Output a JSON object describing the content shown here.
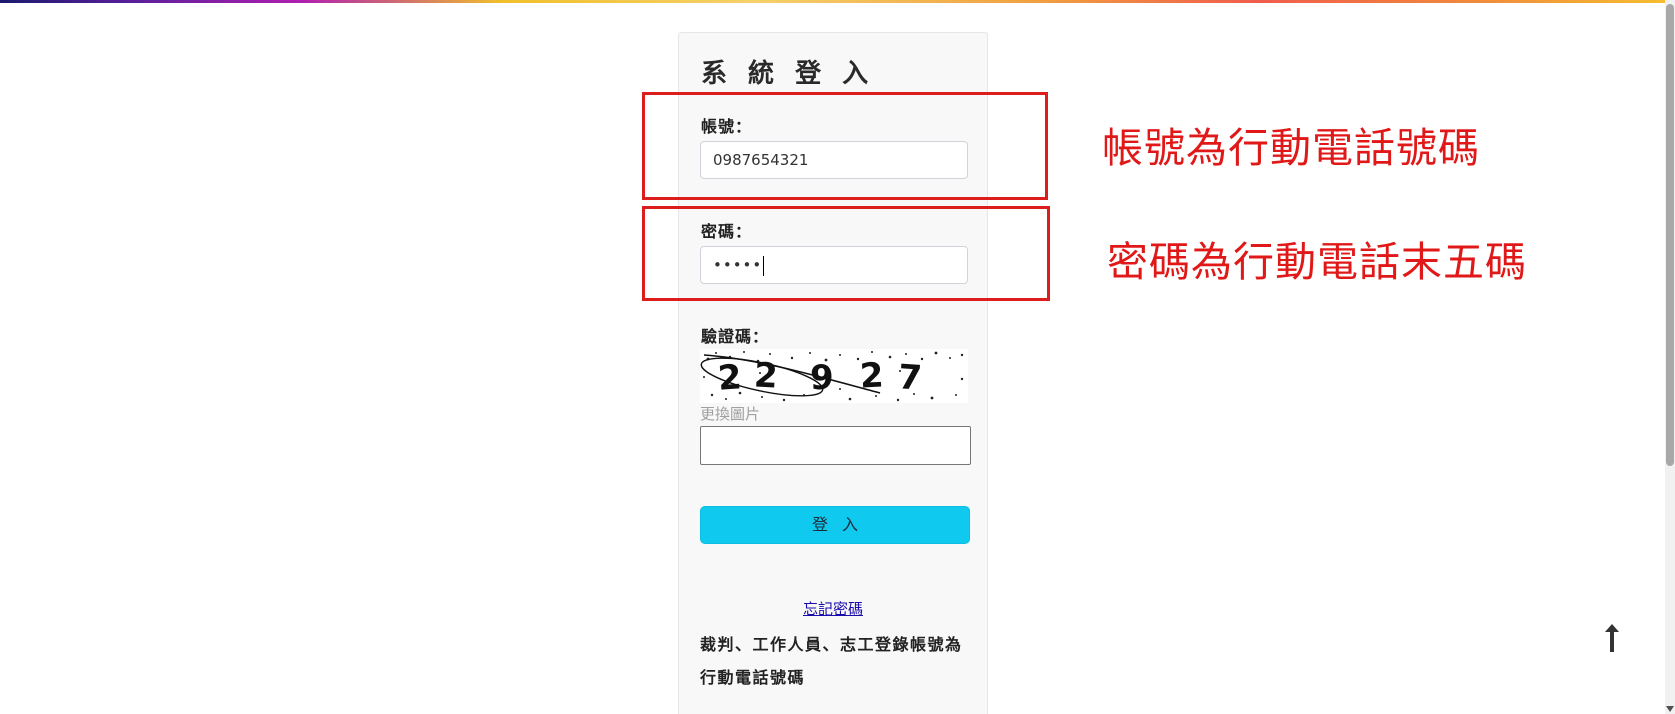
{
  "login": {
    "title": "系 統 登 入",
    "account_label": "帳號：",
    "account_value": "0987654321",
    "password_label": "密碼：",
    "password_dots": "•••••",
    "captcha_label": "驗證碼：",
    "captcha_text": "22927",
    "change_image": "更換圖片",
    "captcha_value": "",
    "submit_label": "登入",
    "forgot_password": "忘記密碼",
    "note": "裁判、工作人員、志工登錄帳號為行動電話號碼"
  },
  "annotations": {
    "account_hint": "帳號為行動電話號碼",
    "password_hint": "密碼為行動電話末五碼",
    "color": "#e01818"
  },
  "icons": {
    "back_to_top": "arrow-up-icon"
  },
  "colors": {
    "button": "#10c9ee",
    "highlight_box": "#dd1c1c",
    "link": "#1a0dab"
  }
}
